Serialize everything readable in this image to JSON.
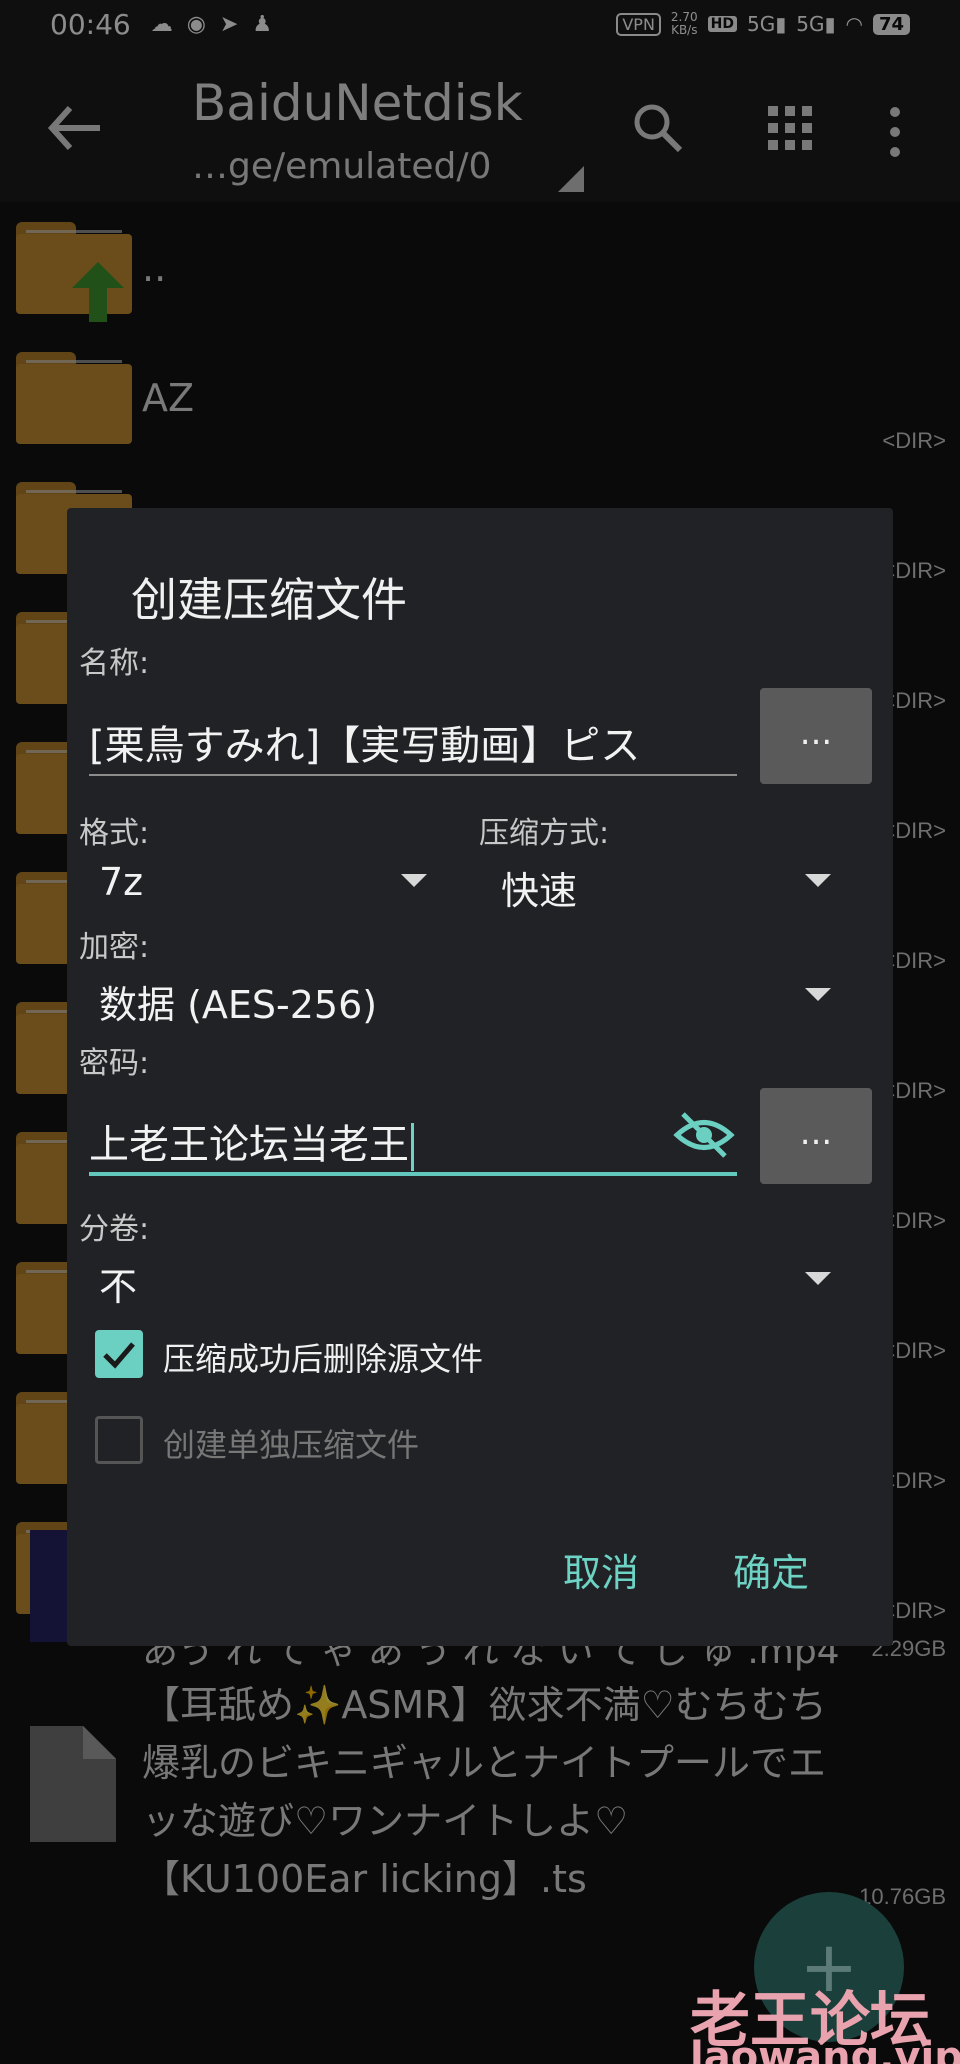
{
  "status_bar": {
    "time": "00:46",
    "vpn": "VPN",
    "speed_value": "2.70",
    "speed_unit": "KB/s",
    "hd": "HD",
    "net1": "5G",
    "net2": "5G",
    "battery": "74"
  },
  "app_bar": {
    "title": "BaiduNetdisk",
    "path": "…ge/emulated/0"
  },
  "file_list": {
    "parent": "..",
    "folder_az": "AZ",
    "dir_tag": "<DIR>",
    "partial_filename": "あう れ て ゃ あ う れ な い て じ ゅ .mp4",
    "partial_size": "2.29GB",
    "big_filename": "【耳舐め✨ASMR】欲求不満♡むちむち爆乳のビキニギャルとナイトプールでエッな遊び♡ワンナイトしよ♡【KU100Ear licking】.ts",
    "big_size": "10.76GB"
  },
  "fab": {
    "label": "+"
  },
  "watermark": {
    "text": "老王论坛",
    "sub": "laowang.vip"
  },
  "dialog": {
    "title": "创建压缩文件",
    "name_label": "名称:",
    "name_value": "[栗鳥すみれ]【実写動画】ピス",
    "browse_label": "...",
    "format_label": "格式:",
    "format_value": "7z",
    "method_label": "压缩方式:",
    "method_value": "快速",
    "encrypt_label": "加密:",
    "encrypt_value": "数据 (AES-256)",
    "password_label": "密码:",
    "password_value": "上老王论坛当老王",
    "password_more_label": "...",
    "volume_label": "分卷:",
    "volume_value": "不",
    "delete_source_label": "压缩成功后删除源文件",
    "delete_source_checked": true,
    "separate_archive_label": "创建单独压缩文件",
    "separate_archive_checked": false,
    "cancel_label": "取消",
    "ok_label": "确定"
  }
}
